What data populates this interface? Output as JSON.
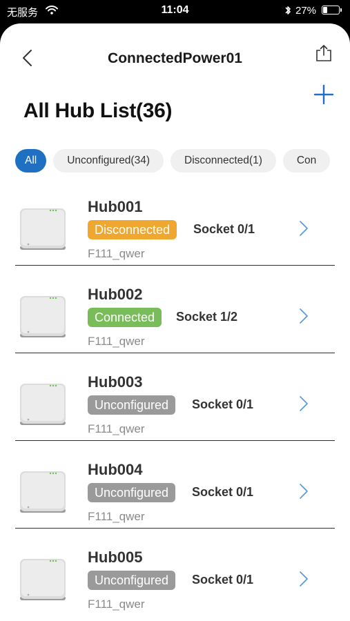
{
  "status_bar": {
    "carrier": "无服务",
    "time": "11:04",
    "battery_pct": "27%",
    "battery_level": 0.27
  },
  "nav": {
    "title": "ConnectedPower01",
    "back_icon": "chevron-left-icon",
    "share_icon": "share-icon",
    "add_icon": "plus-icon"
  },
  "page": {
    "title": "All Hub List(36)"
  },
  "filters": [
    {
      "label": "All",
      "active": true
    },
    {
      "label": "Unconfigured(34)",
      "active": false
    },
    {
      "label": "Disconnected(1)",
      "active": false
    },
    {
      "label": "Con",
      "active": false
    }
  ],
  "status_colors": {
    "Disconnected": "#f0a72f",
    "Connected": "#79bd5a",
    "Unconfigured": "#9a9a9a"
  },
  "hubs": [
    {
      "name": "Hub001",
      "status": "Disconnected",
      "socket": "Socket 0/1",
      "sub": "F111_qwer"
    },
    {
      "name": "Hub002",
      "status": "Connected",
      "socket": "Socket 1/2",
      "sub": "F111_qwer"
    },
    {
      "name": "Hub003",
      "status": "Unconfigured",
      "socket": "Socket 0/1",
      "sub": "F111_qwer"
    },
    {
      "name": "Hub004",
      "status": "Unconfigured",
      "socket": "Socket 0/1",
      "sub": "F111_qwer"
    },
    {
      "name": "Hub005",
      "status": "Unconfigured",
      "socket": "Socket 0/1",
      "sub": "F111_qwer"
    }
  ]
}
